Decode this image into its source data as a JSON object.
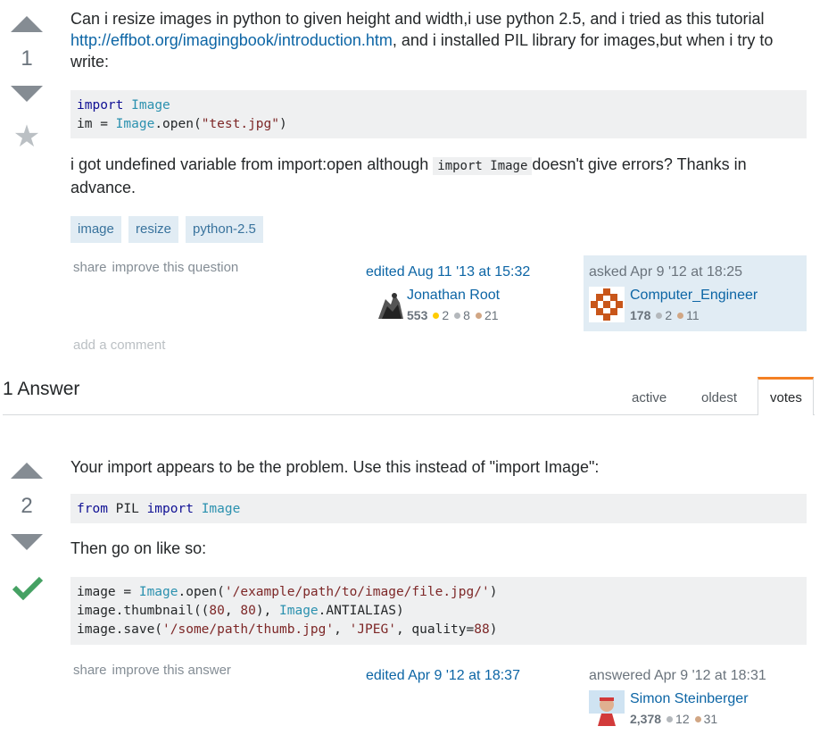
{
  "question": {
    "votes": "1",
    "body_p1_a": "Can i resize images in python to given height and width,i use python 2.5, and i tried as this tutorial ",
    "body_p1_link": "http://effbot.org/imagingbook/introduction.htm",
    "body_p1_b": ", and i installed PIL library for images,but when i try to write:",
    "code_l1_kw": "import",
    "code_l1_tp": "Image",
    "code_l2_a": "im = ",
    "code_l2_tp": "Image",
    "code_l2_b": ".open(",
    "code_l2_st": "\"test.jpg\"",
    "code_l2_c": ")",
    "body_p2_a": "i got undefined variable from import:open although ",
    "body_p2_code": "import Image",
    "body_p2_b": "doesn't give errors? Thanks in advance.",
    "tags": [
      "image",
      "resize",
      "python-2.5"
    ],
    "menu_share": "share",
    "menu_improve": "improve this question",
    "edited_label": "edited Aug 11 '13 at 15:32",
    "editor_name": "Jonathan Root",
    "editor_rep": "553",
    "editor_gold": "2",
    "editor_silver": "8",
    "editor_bronze": "21",
    "asked_label": "asked Apr 9 '12 at 18:25",
    "asker_name": "Computer_Engineer",
    "asker_rep": "178",
    "asker_silver": "2",
    "asker_bronze": "11",
    "add_comment": "add a comment"
  },
  "answers_header": {
    "title": "1 Answer",
    "tabs": [
      "active",
      "oldest",
      "votes"
    ],
    "active_tab": "votes"
  },
  "answer": {
    "votes": "2",
    "p1": "Your import appears to be the problem. Use this instead of \"import Image\":",
    "code1_kw1": "from",
    "code1_mid": " PIL ",
    "code1_kw2": "import",
    "code1_tp": "Image",
    "p2": "Then go on like so:",
    "code2_l1_a": "image = ",
    "code2_l1_tp": "Image",
    "code2_l1_b": ".open(",
    "code2_l1_st": "'/example/path/to/image/file.jpg/'",
    "code2_l1_c": ")",
    "code2_l2_a": "image.thumbnail((",
    "code2_l2_n1": "80",
    "code2_l2_b": ", ",
    "code2_l2_n2": "80",
    "code2_l2_c": "), ",
    "code2_l2_tp": "Image",
    "code2_l2_d": ".ANTIALIAS)",
    "code2_l3_a": "image.save(",
    "code2_l3_st1": "'/some/path/thumb.jpg'",
    "code2_l3_b": ", ",
    "code2_l3_st2": "'JPEG'",
    "code2_l3_c": ", quality=",
    "code2_l3_n": "88",
    "code2_l3_d": ")",
    "menu_share": "share",
    "menu_improve": "improve this answer",
    "edited_label": "edited Apr 9 '12 at 18:37",
    "answered_label": "answered Apr 9 '12 at 18:31",
    "answerer_name": "Simon Steinberger",
    "answerer_rep": "2,378",
    "answerer_silver": "12",
    "answerer_bronze": "31"
  },
  "icons": {
    "upvote": "upvote-arrow-icon",
    "downvote": "downvote-arrow-icon",
    "favorite": "star-icon",
    "accepted": "checkmark-icon"
  },
  "colors": {
    "link": "#0c65a5",
    "tag_bg": "#e1ecf4",
    "tag_text": "#39739d",
    "accepted": "#45a163",
    "active_tab": "#f48024",
    "signature_bg": "#e1ecf4"
  }
}
